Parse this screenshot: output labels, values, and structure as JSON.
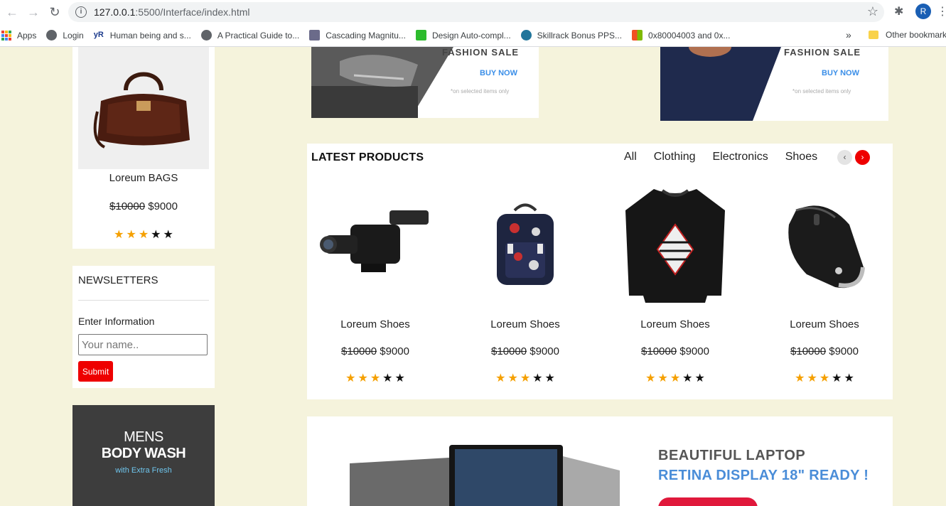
{
  "browser": {
    "url_host": "127.0.0.1",
    "url_rest": ":5500/Interface/index.html",
    "profile_initial": "R",
    "bookmarks": [
      {
        "label": "Apps",
        "icon": "apps-grid-icon"
      },
      {
        "label": "Login",
        "icon": "globe-icon"
      },
      {
        "label": "Human being and s...",
        "icon": "yr-icon"
      },
      {
        "label": "A Practical Guide to...",
        "icon": "globe-icon"
      },
      {
        "label": "Cascading Magnitu...",
        "icon": "page-icon"
      },
      {
        "label": "Design Auto-compl...",
        "icon": "green-icon"
      },
      {
        "label": "Skillrack Bonus PPS...",
        "icon": "wordpress-icon"
      },
      {
        "label": "0x80004003 and 0x...",
        "icon": "windows-icon"
      }
    ],
    "more_bookmarks": "»",
    "other_bookmarks": "Other bookmarks"
  },
  "featured": {
    "title": "Loreum BAGS",
    "old_price": "$10000",
    "price": "$9000",
    "rating": 3,
    "max_rating": 5
  },
  "newsletter": {
    "title": "NEWSLETTERS",
    "label": "Enter Information",
    "placeholder": "Your name..",
    "submit": "Submit"
  },
  "side_ad": {
    "line1": "MENS",
    "line2": "BODY WASH",
    "line3": "with Extra Fresh"
  },
  "banners": [
    {
      "title": "FASHION SALE",
      "cta": "BUY NOW",
      "note": "*on selected items only"
    },
    {
      "title": "FASHION SALE",
      "cta": "BUY NOW",
      "note": "*on selected items only"
    }
  ],
  "latest": {
    "heading": "LATEST PRODUCTS",
    "filters": [
      "All",
      "Clothing",
      "Electronics",
      "Shoes"
    ],
    "prev": "‹",
    "next": "›",
    "products": [
      {
        "name": "Loreum Shoes",
        "old_price": "$10000",
        "price": "$9000",
        "rating": 3,
        "image": "camcorder"
      },
      {
        "name": "Loreum Shoes",
        "old_price": "$10000",
        "price": "$9000",
        "rating": 3,
        "image": "backpack"
      },
      {
        "name": "Loreum Shoes",
        "old_price": "$10000",
        "price": "$9000",
        "rating": 3,
        "image": "sweatshirt"
      },
      {
        "name": "Loreum Shoes",
        "old_price": "$10000",
        "price": "$9000",
        "rating": 3,
        "image": "mouse"
      }
    ]
  },
  "laptop_ad": {
    "title": "BEAUTIFUL LAPTOP",
    "subtitle": "RETINA DISPLAY 18\" READY !"
  },
  "colors": {
    "page_bg": "#f5f3dc",
    "accent_red": "#ee0000",
    "star_gold": "#f5a000"
  }
}
